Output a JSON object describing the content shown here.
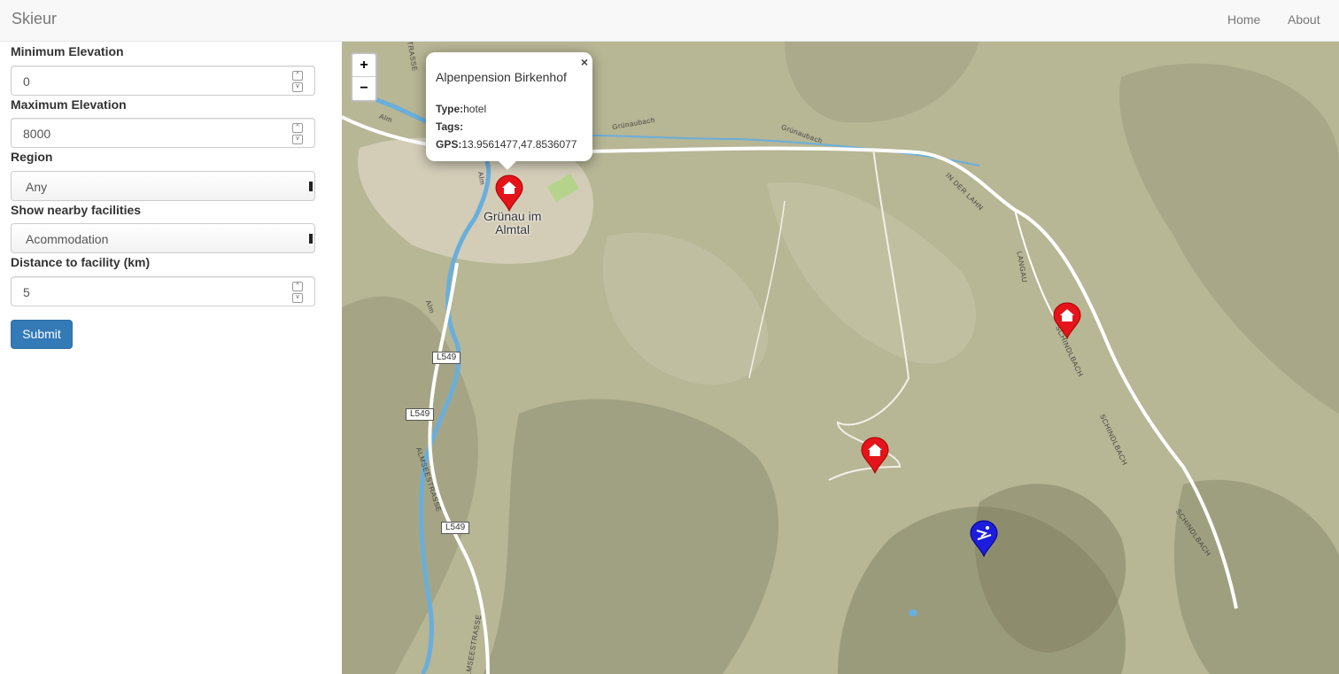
{
  "navbar": {
    "brand": "Skieur",
    "links": [
      "Home",
      "About"
    ]
  },
  "form": {
    "min_elevation": {
      "label": "Minimum Elevation",
      "value": "0"
    },
    "max_elevation": {
      "label": "Maximum Elevation",
      "value": "8000"
    },
    "region": {
      "label": "Region",
      "selected": "Any"
    },
    "facilities": {
      "label": "Show nearby facilities",
      "selected": "Acommodation"
    },
    "distance": {
      "label": "Distance to facility (km)",
      "value": "5"
    },
    "submit_label": "Submit"
  },
  "map": {
    "zoom_in": "+",
    "zoom_out": "−",
    "popup": {
      "title": "Alpenpension Birkenhof",
      "close": "×",
      "type_label": "Type:",
      "type_value": "hotel",
      "tags_label": "Tags:",
      "tags_value": "",
      "gps_label": "GPS:",
      "gps_value": "13.9561477,47.8536077"
    },
    "place_label": "Grünau im\nAlmtal",
    "road_labels": [
      "L549",
      "L549",
      "L549"
    ],
    "street_labels": [
      "ALMSEESTRASSE",
      "ALMSEESTRASSE",
      "IN DER LAHN",
      "LANGAU",
      "SCHINDLBACH",
      "SCHINDLBACH",
      "SCHINDLBACH",
      "Grünaubach",
      "Grünaubach",
      "Alm",
      "Alm",
      "Alm",
      "TRASSE"
    ],
    "markers": [
      {
        "name": "hotel-marker-birkenhof",
        "icon": "house-icon",
        "color": "#e5141a"
      },
      {
        "name": "hotel-marker-schindlbach",
        "icon": "house-icon",
        "color": "#e5141a"
      },
      {
        "name": "hotel-marker-south",
        "icon": "house-icon",
        "color": "#e5141a"
      },
      {
        "name": "ski-marker",
        "icon": "skier-icon",
        "color": "#1d1dde"
      }
    ]
  },
  "colors": {
    "primary": "#337ab7",
    "hotel_marker": "#e5141a",
    "ski_marker": "#1d1dde"
  }
}
